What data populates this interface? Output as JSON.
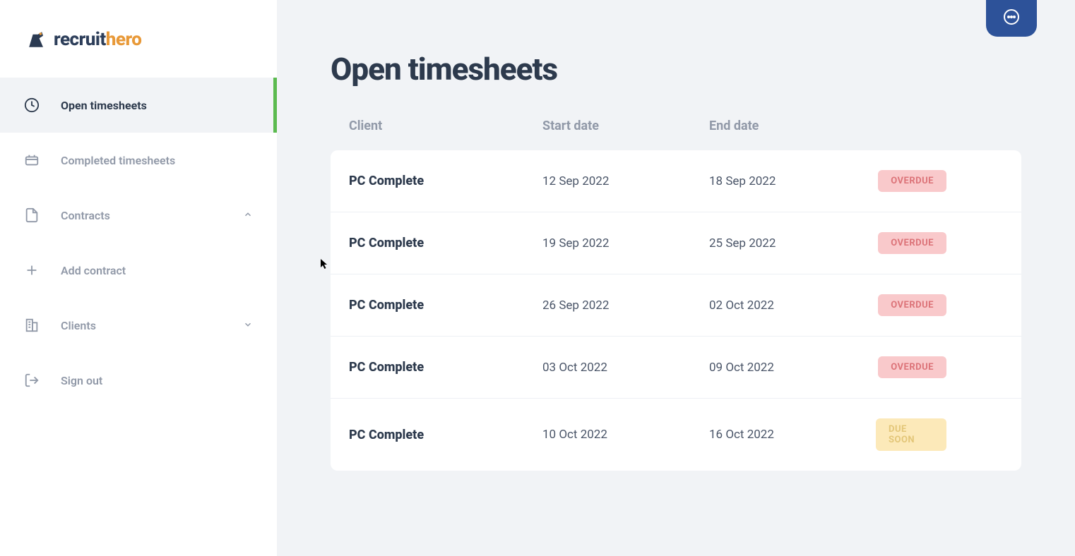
{
  "brand": {
    "name_part1": "recruit",
    "name_part2": "hero"
  },
  "sidebar": {
    "items": [
      {
        "label": "Open timesheets",
        "icon": "clock",
        "active": true
      },
      {
        "label": "Completed timesheets",
        "icon": "inbox",
        "active": false
      },
      {
        "label": "Contracts",
        "icon": "document",
        "active": false,
        "expandable": true,
        "expanded": true
      },
      {
        "label": "Add contract",
        "icon": "plus",
        "active": false
      },
      {
        "label": "Clients",
        "icon": "building",
        "active": false,
        "expandable": true,
        "expanded": false
      },
      {
        "label": "Sign out",
        "icon": "signout",
        "active": false
      }
    ]
  },
  "page": {
    "title": "Open timesheets"
  },
  "table": {
    "columns": {
      "client": "Client",
      "start_date": "Start date",
      "end_date": "End date"
    },
    "rows": [
      {
        "client": "PC Complete",
        "start_date": "12 Sep 2022",
        "end_date": "18 Sep 2022",
        "status": "OVERDUE",
        "status_type": "overdue"
      },
      {
        "client": "PC Complete",
        "start_date": "19 Sep 2022",
        "end_date": "25 Sep 2022",
        "status": "OVERDUE",
        "status_type": "overdue"
      },
      {
        "client": "PC Complete",
        "start_date": "26 Sep 2022",
        "end_date": "02 Oct 2022",
        "status": "OVERDUE",
        "status_type": "overdue"
      },
      {
        "client": "PC Complete",
        "start_date": "03 Oct 2022",
        "end_date": "09 Oct 2022",
        "status": "OVERDUE",
        "status_type": "overdue"
      },
      {
        "client": "PC Complete",
        "start_date": "10 Oct 2022",
        "end_date": "16 Oct 2022",
        "status": "DUE SOON",
        "status_type": "duesoon"
      }
    ]
  }
}
